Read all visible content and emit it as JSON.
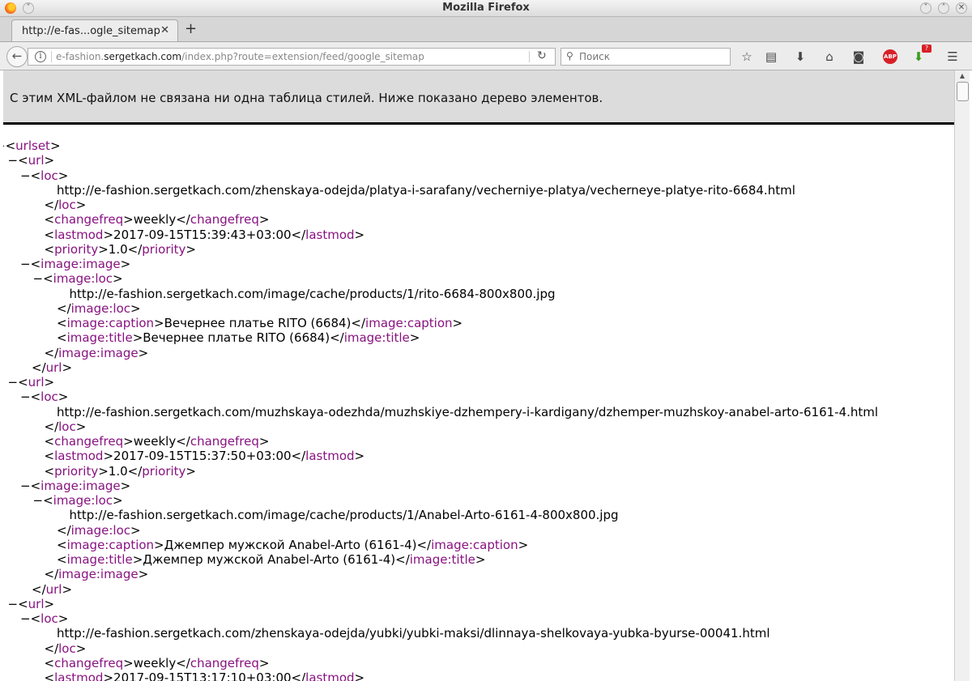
{
  "window": {
    "title": "Mozilla Firefox"
  },
  "tabs": [
    {
      "label": "http://e-fas...ogle_sitemap"
    }
  ],
  "urlbar": {
    "prefix": "e-fashion.",
    "host": "sergetkach.com",
    "path": "/index.php?route=extension/feed/google_sitemap"
  },
  "search": {
    "placeholder": "Поиск"
  },
  "toolbar": {
    "abp_label": "ABP",
    "download_badge": "?"
  },
  "xml_viewer": {
    "message": "С этим XML-файлом не связана ни одна таблица стилей. Ниже показано дерево элементов."
  },
  "tree": [
    {
      "indent": 0,
      "toggle": "−",
      "open": "urlset"
    },
    {
      "indent": 1,
      "toggle": "−",
      "open": "url"
    },
    {
      "indent": 2,
      "toggle": "−",
      "open": "loc"
    },
    {
      "indent": 4,
      "text": "http://e-fashion.sergetkach.com/zhenskaya-odejda/platya-i-sarafany/vecherniye-platya/vecherneye-platye-rito-6684.html"
    },
    {
      "indent": 3,
      "close": "loc"
    },
    {
      "indent": 3,
      "open": "changefreq",
      "text": "weekly",
      "close": "changefreq"
    },
    {
      "indent": 3,
      "open": "lastmod",
      "text": "2017-09-15T15:39:43+03:00",
      "close": "lastmod"
    },
    {
      "indent": 3,
      "open": "priority",
      "text": "1.0",
      "close": "priority"
    },
    {
      "indent": 2,
      "toggle": "−",
      "open": "image:image"
    },
    {
      "indent": 3,
      "toggle": "−",
      "open": "image:loc"
    },
    {
      "indent": 5,
      "text": "http://e-fashion.sergetkach.com/image/cache/products/1/rito-6684-800x800.jpg"
    },
    {
      "indent": 4,
      "close": "image:loc"
    },
    {
      "indent": 4,
      "open": "image:caption",
      "text": "Вечернее платье RITO (6684)",
      "close": "image:caption"
    },
    {
      "indent": 4,
      "open": "image:title",
      "text": "Вечернее платье RITO (6684)",
      "close": "image:title"
    },
    {
      "indent": 3,
      "close": "image:image"
    },
    {
      "indent": 2,
      "close": "url"
    },
    {
      "indent": 1,
      "toggle": "−",
      "open": "url"
    },
    {
      "indent": 2,
      "toggle": "−",
      "open": "loc"
    },
    {
      "indent": 4,
      "text": "http://e-fashion.sergetkach.com/muzhskaya-odezhda/muzhskiye-dzhempery-i-kardigany/dzhemper-muzhskoy-anabel-arto-6161-4.html"
    },
    {
      "indent": 3,
      "close": "loc"
    },
    {
      "indent": 3,
      "open": "changefreq",
      "text": "weekly",
      "close": "changefreq"
    },
    {
      "indent": 3,
      "open": "lastmod",
      "text": "2017-09-15T15:37:50+03:00",
      "close": "lastmod"
    },
    {
      "indent": 3,
      "open": "priority",
      "text": "1.0",
      "close": "priority"
    },
    {
      "indent": 2,
      "toggle": "−",
      "open": "image:image"
    },
    {
      "indent": 3,
      "toggle": "−",
      "open": "image:loc"
    },
    {
      "indent": 5,
      "text": "http://e-fashion.sergetkach.com/image/cache/products/1/Anabel-Arto-6161-4-800x800.jpg"
    },
    {
      "indent": 4,
      "close": "image:loc"
    },
    {
      "indent": 4,
      "open": "image:caption",
      "text": "Джемпер мужской Anabel-Arto (6161-4)",
      "close": "image:caption"
    },
    {
      "indent": 4,
      "open": "image:title",
      "text": "Джемпер мужской Anabel-Arto (6161-4)",
      "close": "image:title"
    },
    {
      "indent": 3,
      "close": "image:image"
    },
    {
      "indent": 2,
      "close": "url"
    },
    {
      "indent": 1,
      "toggle": "−",
      "open": "url"
    },
    {
      "indent": 2,
      "toggle": "−",
      "open": "loc"
    },
    {
      "indent": 4,
      "text": "http://e-fashion.sergetkach.com/zhenskaya-odejda/yubki/yubki-maksi/dlinnaya-shelkovaya-yubka-byurse-00041.html"
    },
    {
      "indent": 3,
      "close": "loc"
    },
    {
      "indent": 3,
      "open": "changefreq",
      "text": "weekly",
      "close": "changefreq"
    },
    {
      "indent": 3,
      "open": "lastmod",
      "text": "2017-09-15T13:17:10+03:00",
      "close": "lastmod"
    }
  ]
}
